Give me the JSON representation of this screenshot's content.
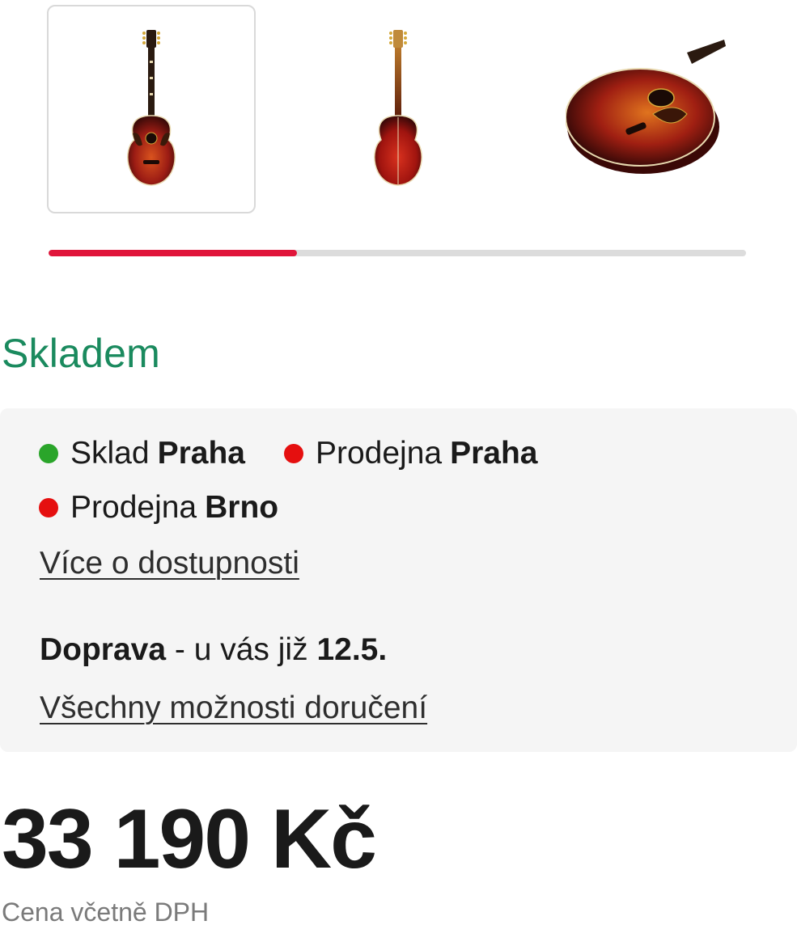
{
  "gallery": {
    "thumbnails": [
      {
        "icon": "guitar-front-icon",
        "active": true
      },
      {
        "icon": "guitar-back-icon",
        "active": false
      },
      {
        "icon": "guitar-body-angle-icon",
        "active": false
      }
    ],
    "progress_fraction": 0.356,
    "progress_color": "#e0153a"
  },
  "stock": {
    "status": "Skladem",
    "status_color": "#1a8a5e"
  },
  "availability": {
    "stores": [
      {
        "prefix": "Sklad",
        "name": "Praha",
        "status_color": "#2aa52a"
      },
      {
        "prefix": "Prodejna",
        "name": "Praha",
        "status_color": "#e50f0f"
      },
      {
        "prefix": "Prodejna",
        "name": "Brno",
        "status_color": "#e50f0f"
      }
    ],
    "more_link": "Více o dostupnosti"
  },
  "shipping": {
    "label": "Doprava",
    "text": " - u vás již ",
    "date": "12.5.",
    "all_options_link": "Všechny možnosti doručení"
  },
  "price": {
    "amount": "33 190 Kč",
    "vat_note": "Cena včetně DPH"
  }
}
